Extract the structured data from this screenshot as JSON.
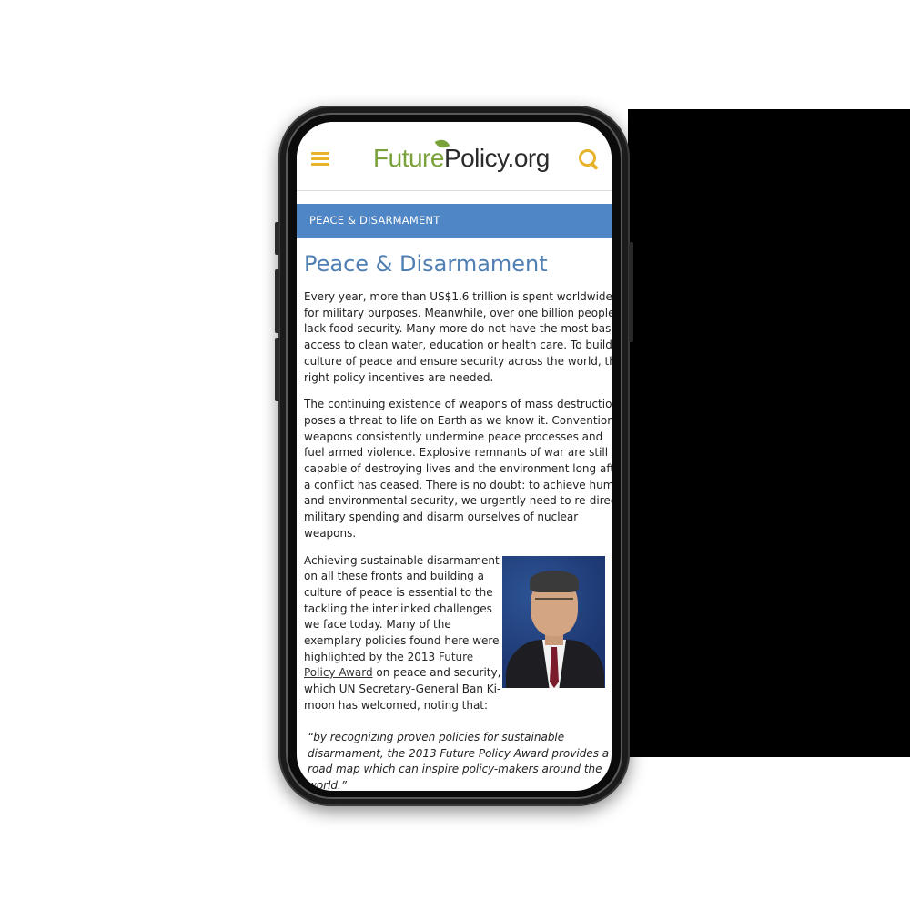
{
  "site": {
    "logo_part1": "Future",
    "logo_part2": "Policy.org",
    "menu_icon": "hamburger-menu-icon",
    "search_icon": "magnifier-search-icon",
    "accent_color": "#e7b32a",
    "logo_green": "#7aa23a"
  },
  "section_bar": {
    "label": "PEACE & DISARMAMENT",
    "color": "#4f86c6"
  },
  "page": {
    "title": "Peace & Disarmament",
    "paragraph1": [
      "Every year, more than US$1.6 trillion  is spent worldwide",
      "for military purposes. Meanwhile, over one billion people",
      "lack food security. Many more do not have the most basic",
      "access to clean water, education or health care. To build a",
      "culture of peace and ensure security across the world, the",
      "right policy incentives are needed."
    ],
    "paragraph2": [
      "The continuing existence of weapons of mass destruction",
      "poses a threat to life on Earth as we know it. Conventional",
      "weapons consistently undermine peace processes and",
      "fuel armed violence. Explosive remnants of war are still",
      "capable of destroying lives and the environment long after",
      "a conflict has ceased. There is no doubt: to achieve human",
      "and environmental security, we urgently need to re-direct",
      "military spending and disarm ourselves of nuclear",
      "weapons."
    ],
    "paragraph3": {
      "line1": "Achieving sustainable disarmament",
      "line2": "on all these fronts and building a",
      "line3": "culture of peace is essential to the",
      "line4": "tackling the interlinked challenges",
      "line5": "we face today. Many of the",
      "line6": "exemplary policies found here were",
      "line7_prefix": "highlighted by the 2013 ",
      "line7_link": "Future",
      "line8_link": "Policy Award",
      "line8_suffix": " on peace and security,",
      "line9": "which UN Secretary-General Ban Ki-",
      "line10": "moon has welcomed, noting that:"
    },
    "quote": [
      "“by recognizing proven policies for sustainable",
      "disarmament, the 2013 Future Policy Award provides a",
      "road map which can inspire policy-makers around the",
      "world.”"
    ]
  }
}
